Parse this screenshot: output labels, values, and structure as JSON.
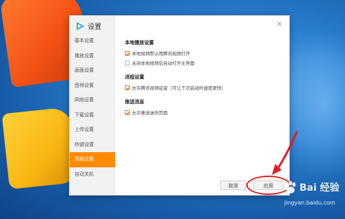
{
  "dialog": {
    "title": "设置",
    "close_glyph": "×"
  },
  "sidebar": {
    "items": [
      {
        "label": "基本设置"
      },
      {
        "label": "播放设置"
      },
      {
        "label": "画面设置"
      },
      {
        "label": "音频设置"
      },
      {
        "label": "网络设置"
      },
      {
        "label": "下载设置"
      },
      {
        "label": "上传设置"
      },
      {
        "label": "热键设置"
      },
      {
        "label": "高级设置",
        "active": true
      },
      {
        "label": "自动关机"
      }
    ]
  },
  "sections": [
    {
      "title": "本地播放设置",
      "options": [
        {
          "label": "本地视频默认用腾讯视频打开",
          "checked": true
        },
        {
          "label": "关闭本地视频后自动打开主界面",
          "checked": false
        }
      ]
    },
    {
      "title": "进程设置",
      "options": [
        {
          "label": "允许腾讯视频驻留（可让下次启动时速度更快）",
          "checked": true
        }
      ]
    },
    {
      "title": "推送消息",
      "options": [
        {
          "label": "允许推送迷你页面",
          "checked": true
        }
      ]
    }
  ],
  "buttons": {
    "cancel": "取消",
    "apply": "应用"
  },
  "watermark": {
    "brand": "Bai 经验",
    "url": "jingyan.baidu.com"
  },
  "colors": {
    "accent": "#ff8a00",
    "highlight_ring": "#e31b1b"
  }
}
